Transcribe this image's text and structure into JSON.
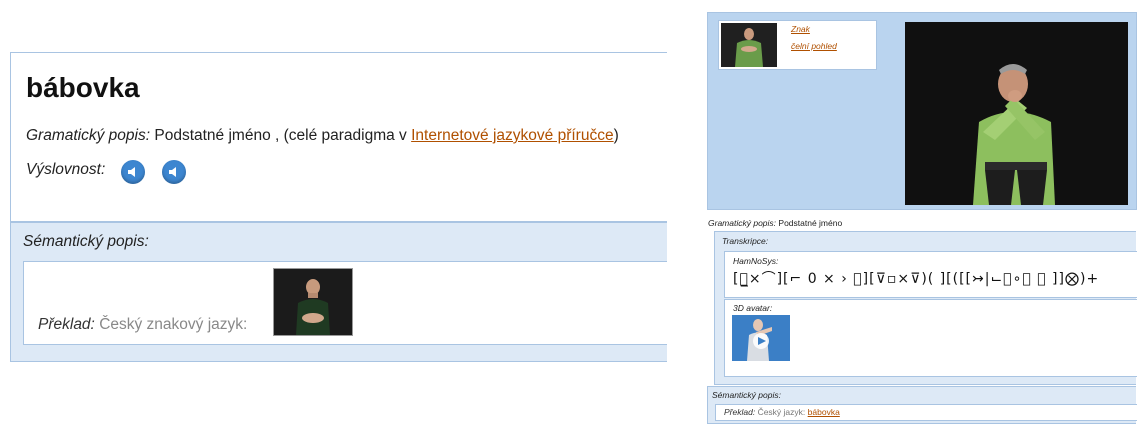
{
  "entry": {
    "word": "bábovka",
    "gram_label": "Gramatický popis:",
    "gram_value": "Podstatné jméno",
    "paradigm_prefix": ", (celé paradigma v ",
    "paradigm_link": "Internetové jazykové příručce",
    "paradigm_suffix": ")",
    "pron_label": "Výslovnost:",
    "speaker_icons": [
      "speaker-icon",
      "speaker-icon"
    ]
  },
  "semantic": {
    "title": "Sémantický popis:",
    "translation_label": "Překlad:",
    "translation_value": "Český znakový jazyk:"
  },
  "sign_panel": {
    "links": [
      "Znak",
      "čelní pohled"
    ],
    "gram_label": "Gramatický popis:",
    "gram_value": "Podstatné jméno",
    "transcription_title": "Transkripce:",
    "hamnosys_label": "HamNoSys:",
    "hamnosys_glyphs": "[⌒̲⨯⌒][⌐ 0 ⨯ › ⌣][⊽▫⨯⊽)( ][([[↣|⌙⌣∘⸫ ⸋ ]]⨂)+",
    "avatar_label": "3D avatar:",
    "semantic_title": "Sémantický popis:",
    "translation_label": "Překlad:",
    "translation_value": "Český jazyk:",
    "translation_link": "bábovka"
  },
  "colors": {
    "border": "#a9c4e2",
    "panel_bg": "#dde9f6",
    "video_area_bg": "#bad4ef",
    "link": "#b05000",
    "speaker": "#3d86d0"
  }
}
